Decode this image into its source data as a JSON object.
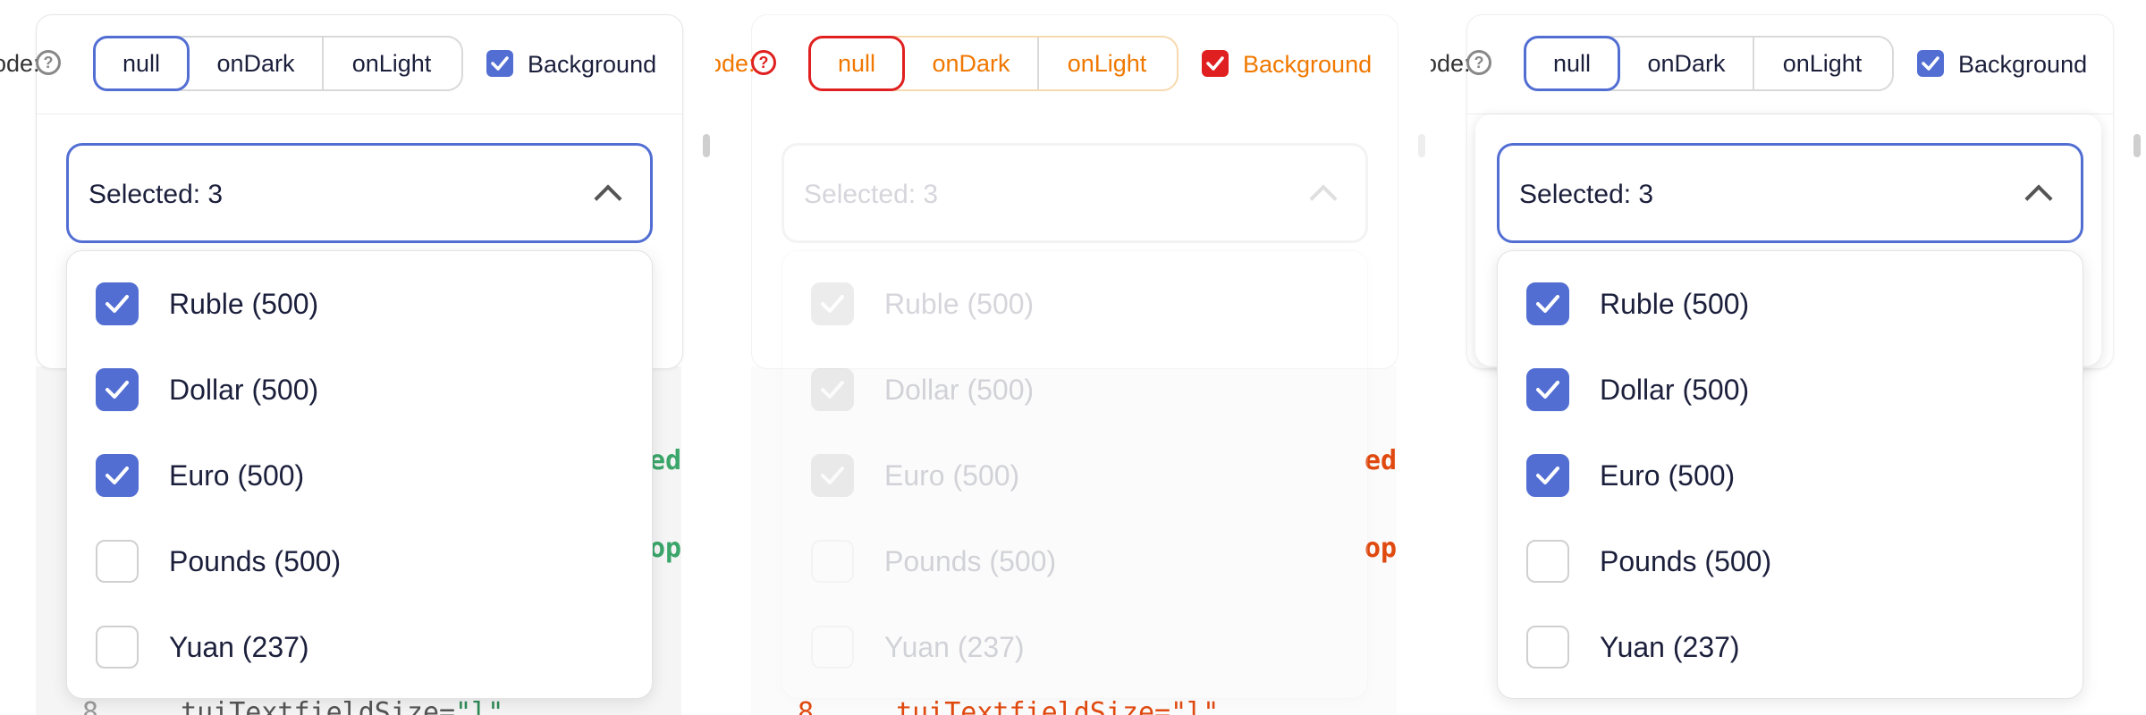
{
  "toolbar": {
    "mode_label": "ode:",
    "mode_label_full": "Mode:",
    "help_glyph": "?",
    "modes": [
      "null",
      "onDark",
      "onLight"
    ],
    "active_mode": "null",
    "background_label": "Background",
    "background_checked": true
  },
  "select": {
    "value_text": "Selected: 3",
    "options": [
      {
        "label": "Ruble (500)",
        "checked": true
      },
      {
        "label": "Dollar (500)",
        "checked": true
      },
      {
        "label": "Euro (500)",
        "checked": true
      },
      {
        "label": "Pounds (500)",
        "checked": false
      },
      {
        "label": "Yuan (237)",
        "checked": false
      }
    ]
  },
  "code": {
    "fragment_1": "ed",
    "fragment_2": "op",
    "line_number": "8",
    "line_text": "tuiTextfieldSize=",
    "line_value": "\"l\""
  },
  "colors": {
    "accent": "#526ed3",
    "text": "#1b1f3b",
    "code_green": "#3aa66a",
    "diff_red": "#e02020",
    "diff_orange": "#f07800"
  },
  "icons": {
    "help": "question-circle-icon",
    "chevron": "chevron-up-icon",
    "check": "check-icon"
  }
}
